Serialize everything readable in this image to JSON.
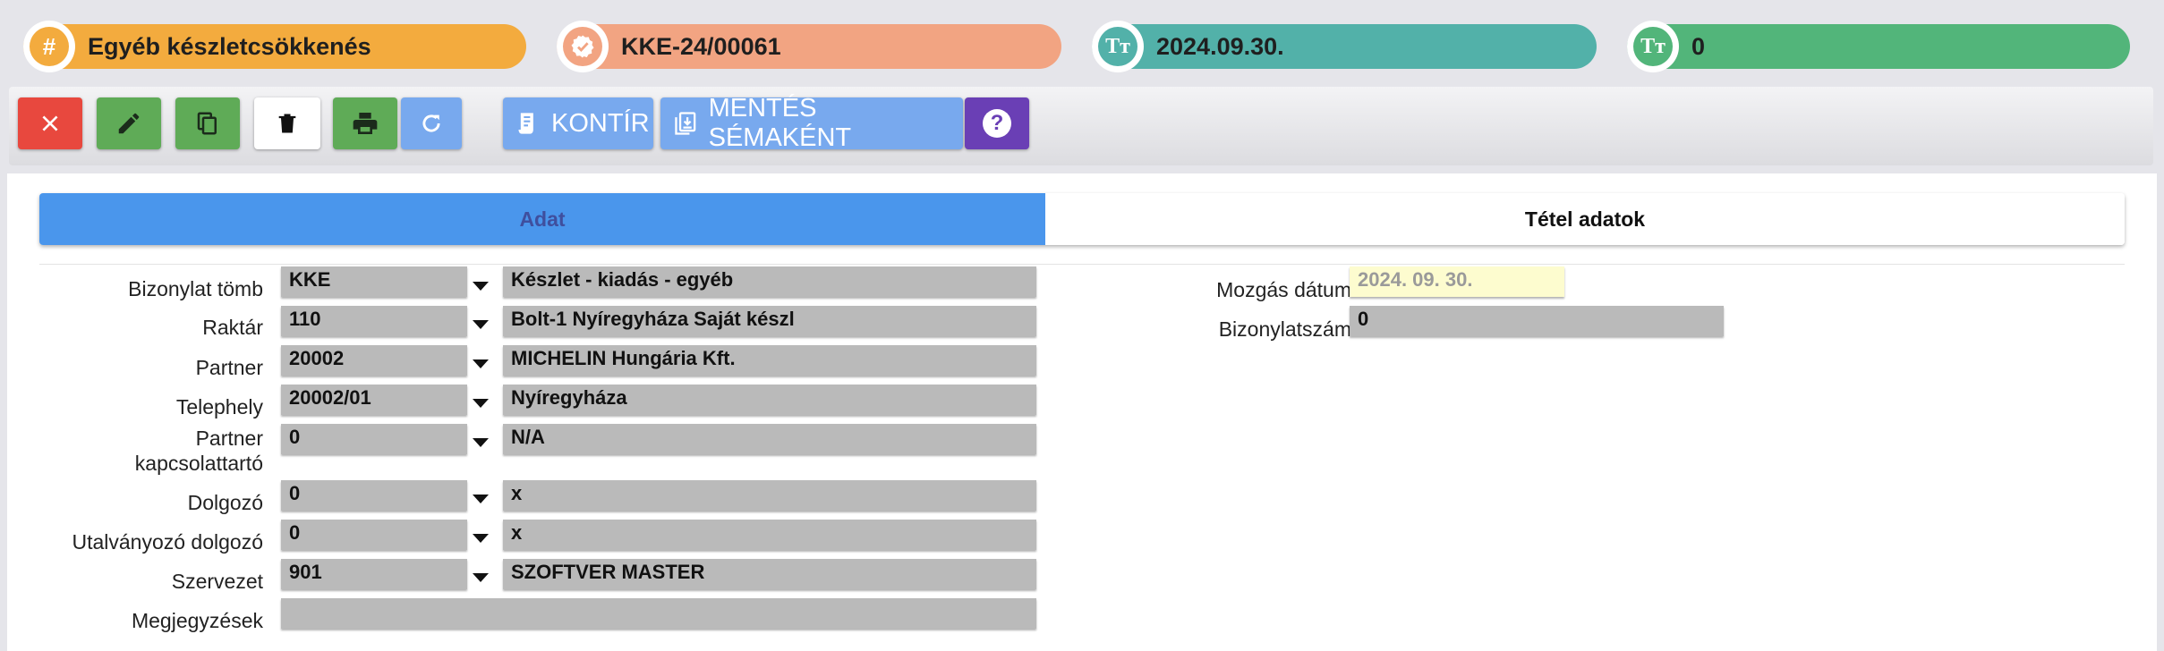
{
  "header": {
    "type": {
      "text": "Egyéb készletcsökkenés",
      "icon": "hash-icon",
      "color": "#f3ab3e"
    },
    "doc_number": {
      "text": "KKE-24/00061",
      "icon": "check-badge-icon",
      "color": "#f2a482"
    },
    "date": {
      "text": "2024.09.30.",
      "icon": "text-size-icon",
      "color": "#52b1a9"
    },
    "value": {
      "text": "0",
      "icon": "text-size-icon",
      "color": "#52b57a"
    }
  },
  "toolbar": {
    "kontir_label": "KONTÍR",
    "save_schema_label": "MENTÉS SÉMAKÉNT",
    "help_label": "?"
  },
  "tabs": [
    {
      "label": "Adat",
      "active": true
    },
    {
      "label": "Tétel adatok",
      "active": false
    }
  ],
  "form": {
    "bizonylat_tomb": {
      "label": "Bizonylat tömb",
      "code": "KKE",
      "name": "Készlet - kiadás - egyéb"
    },
    "raktar": {
      "label": "Raktár",
      "code": "110",
      "name": "Bolt-1 Nyíregyháza Saját készl"
    },
    "partner": {
      "label": "Partner",
      "code": "20002",
      "name": "MICHELIN Hungária Kft."
    },
    "telephely": {
      "label": "Telephely",
      "code": "20002/01",
      "name": "Nyíregyháza"
    },
    "kapcsolattarto": {
      "label_line1": "Partner",
      "label_line2": "kapcsolattartó",
      "code": "0",
      "name": "N/A"
    },
    "dolgozo": {
      "label": "Dolgozó",
      "code": "0",
      "name": "x"
    },
    "utalvanyozo": {
      "label": "Utalványozó dolgozó",
      "code": "0",
      "name": "x"
    },
    "szervezet": {
      "label": "Szervezet",
      "code": "901",
      "name": "SZOFTVER MASTER"
    },
    "megjegyzesek": {
      "label": "Megjegyzések",
      "value": ""
    },
    "mozgas_datum": {
      "label": "Mozgás dátum",
      "value": "2024. 09. 30."
    },
    "bizonylatszam": {
      "label": "Bizonylatszám",
      "value": "0"
    }
  }
}
